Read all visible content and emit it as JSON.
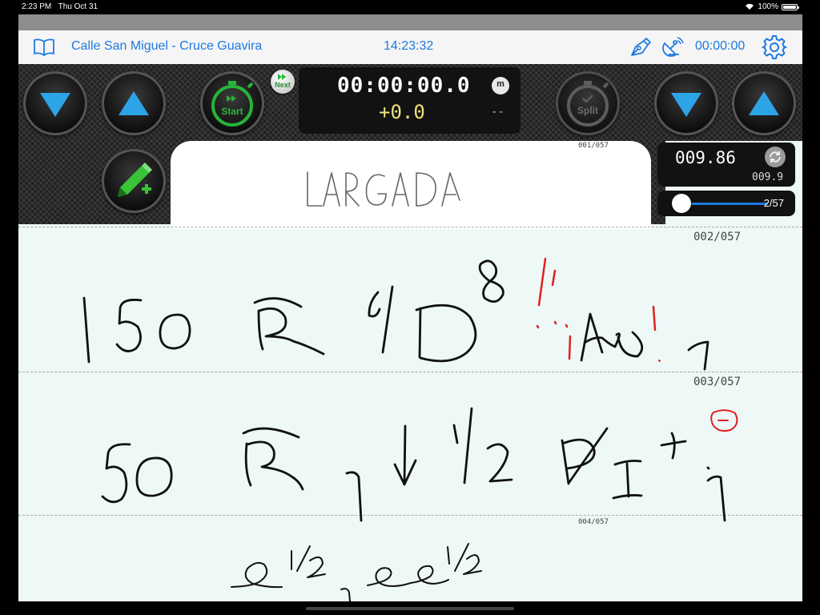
{
  "status_bar": {
    "time": "2:23 PM",
    "date": "Thu Oct 31",
    "battery": "100%"
  },
  "nav": {
    "route_title": "Calle San Miguel - Cruce Guavira",
    "clock": "14:23:32",
    "elapsed": "00:00:00"
  },
  "controls": {
    "start_label": "Start",
    "next_label": "Next",
    "split_label": "Split",
    "timer_main": "00:00:00.0",
    "timer_delta": "+0.0",
    "timer_dash": "--",
    "timer_m": "m"
  },
  "odometer": {
    "value": "009.86",
    "sub_value": "009.9"
  },
  "slider": {
    "position": "2/57",
    "fraction": 0.02
  },
  "pages": {
    "p1": "001/057",
    "p2": "002/057",
    "p3": "003/057",
    "p4": "004/057"
  },
  "colors": {
    "accent": "#1e7ae0",
    "start_green": "#27b43a",
    "pen_green": "#39c437",
    "triangle_blue": "#2da4e6",
    "ink": "#111111",
    "ink_red": "#e02020"
  },
  "icons": [
    "book-icon",
    "pen-nib-icon",
    "satellite-dish-icon",
    "gear-icon",
    "stopwatch-icon",
    "next-icon",
    "reset-icon",
    "pen-add-icon"
  ]
}
